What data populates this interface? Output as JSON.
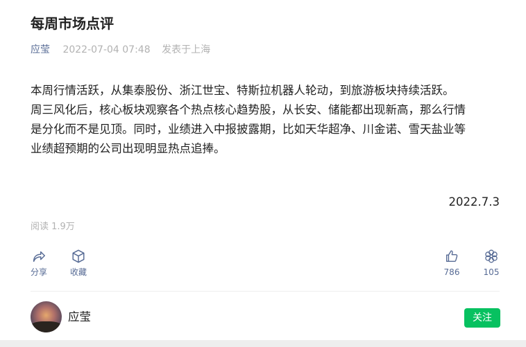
{
  "article": {
    "title": "每周市场点评",
    "author": "应莹",
    "time": "2022-07-04 07:48",
    "location": "发表于上海",
    "paragraphs": [
      "本周行情活跃，从集泰股份、浙江世宝、特斯拉机器人轮动，到旅游板块持续活跃。",
      "周三风化后，核心板块观察各个热点核心趋势股，从长安、储能都出现新高，那么行情",
      "是分化而不是见顶。同时，业绩进入中报披露期，比如天华超净、川金诺、雪天盐业等",
      "业绩超预期的公司出现明显热点追捧。"
    ],
    "signature_date": "2022.7.3",
    "reads": "阅读 1.9万"
  },
  "actions": {
    "share": {
      "label": "分享",
      "icon": "share-icon"
    },
    "collect": {
      "label": "收藏",
      "icon": "cube-icon"
    },
    "like": {
      "count": "786",
      "icon": "thumbs-up-icon"
    },
    "wow": {
      "count": "105",
      "icon": "flower-icon"
    }
  },
  "profile": {
    "name": "应莹",
    "follow_label": "关注"
  },
  "colors": {
    "link": "#576b95",
    "muted": "#b2b2b2",
    "follow": "#07c160"
  }
}
